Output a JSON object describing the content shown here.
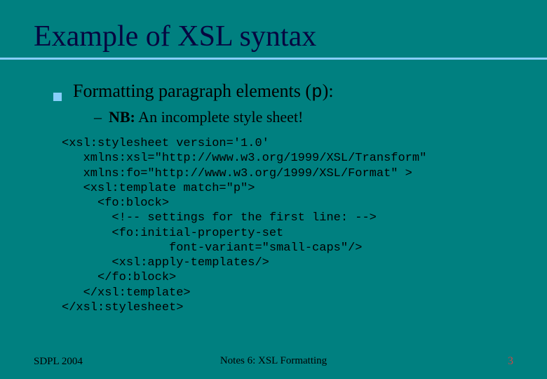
{
  "title": "Example of XSL syntax",
  "bullet": {
    "prefix": "Formatting paragraph elements (",
    "mono": "p",
    "suffix": "):"
  },
  "sub": {
    "dash": "–",
    "nb": "NB:",
    "rest": " An incomplete style sheet!"
  },
  "code": "<xsl:stylesheet version='1.0'\n   xmlns:xsl=\"http://www.w3.org/1999/XSL/Transform\"\n   xmlns:fo=\"http://www.w3.org/1999/XSL/Format\" >\n   <xsl:template match=\"p\">\n     <fo:block>\n       <!-- settings for the first line: -->\n       <fo:initial-property-set\n               font-variant=\"small-caps\"/>\n       <xsl:apply-templates/>\n     </fo:block>\n   </xsl:template>\n</xsl:stylesheet>",
  "footer": {
    "left": "SDPL 2004",
    "center": "Notes 6: XSL Formatting",
    "right": "3"
  }
}
